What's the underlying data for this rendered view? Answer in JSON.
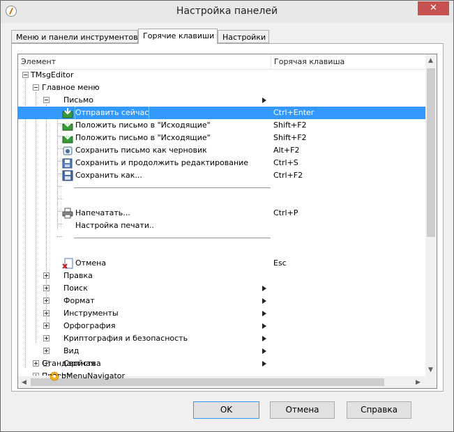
{
  "window": {
    "title": "Настройка панелей",
    "close_glyph": "✕"
  },
  "tabs": [
    {
      "label": "Меню и панели инструментов",
      "active": false
    },
    {
      "label": "Горячие клавиши",
      "active": true
    },
    {
      "label": "Настройки",
      "active": false
    }
  ],
  "grid": {
    "columns": [
      "Элемент",
      "Горячая клавиша"
    ],
    "rows": {
      "tmsgeditor": {
        "label": "TMsgEditor"
      },
      "main_menu": {
        "label": "Главное меню"
      },
      "letter": {
        "label": "Письмо"
      },
      "send_now": {
        "label": "Отправить сейчас",
        "hotkey": "Ctrl+Enter",
        "icon": "send-icon",
        "selected": true
      },
      "outbox_1": {
        "label": "Положить письмо в \"Исходящие\"",
        "hotkey": "Shift+F2",
        "icon": "outbox-icon"
      },
      "outbox_2": {
        "label": "Положить письмо в \"Исходящие\"",
        "hotkey": "Shift+F2",
        "icon": "outbox-icon"
      },
      "save_draft": {
        "label": "Сохранить письмо как черновик",
        "hotkey": "Alt+F2",
        "icon": "draft-icon"
      },
      "save_continue": {
        "label": "Сохранить и продолжить редактирование",
        "hotkey": "Ctrl+S",
        "icon": "save-continue-icon"
      },
      "save_as": {
        "label": "Сохранить как...",
        "hotkey": "Ctrl+F2",
        "icon": "floppy-icon"
      },
      "print": {
        "label": "Напечатать...",
        "hotkey": "Ctrl+P",
        "icon": "printer-icon"
      },
      "print_setup": {
        "label": "Настройка печати.."
      },
      "cancel": {
        "label": "Отмена",
        "hotkey": "Esc",
        "icon": "cancel-doc-icon"
      },
      "edit": {
        "label": "Правка"
      },
      "search": {
        "label": "Поиск"
      },
      "format": {
        "label": "Формат"
      },
      "tools": {
        "label": "Инструменты"
      },
      "spelling": {
        "label": "Орфография"
      },
      "crypto": {
        "label": "Криптография и безопасность"
      },
      "view": {
        "label": "Вид"
      },
      "properties": {
        "label": "Свойства"
      },
      "bmenunavigator": {
        "label": "bMenuNavigator",
        "icon": "gear-icon"
      },
      "standard": {
        "label": "Стандартная"
      },
      "edit_toolbar": {
        "label": "Правка"
      }
    }
  },
  "buttons": {
    "ok": "OK",
    "cancel": "Отмена",
    "help": "Справка"
  },
  "colors": {
    "selection": "#3399ff",
    "close_button": "#c75050"
  }
}
